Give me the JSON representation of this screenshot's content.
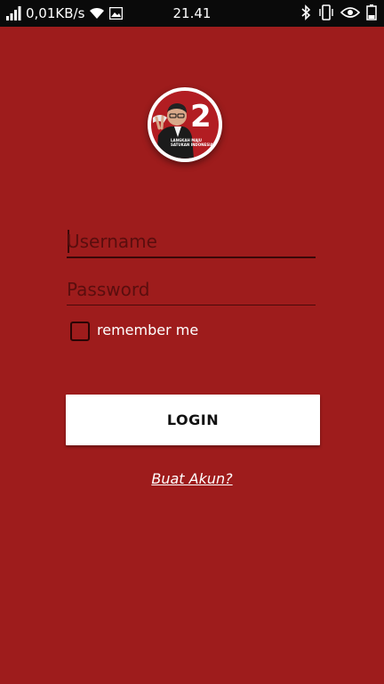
{
  "status_bar": {
    "data_rate": "0,01KB/s",
    "time": "21.41",
    "icons": [
      "signal-icon",
      "wifi-icon",
      "image-icon",
      "bluetooth-icon",
      "vibrate-icon",
      "eye-icon",
      "battery-icon"
    ]
  },
  "logo": {
    "number": "2",
    "caption": "LANGKAH MAJU SATUKAN INDONESIA"
  },
  "form": {
    "username_placeholder": "Username",
    "password_placeholder": "Password",
    "remember_label": "remember me",
    "login_label": "LOGIN",
    "signup_link": "Buat Akun?"
  },
  "colors": {
    "background": "#9e1c1c",
    "status_bar": "#0a0a0a",
    "button": "#ffffff"
  }
}
